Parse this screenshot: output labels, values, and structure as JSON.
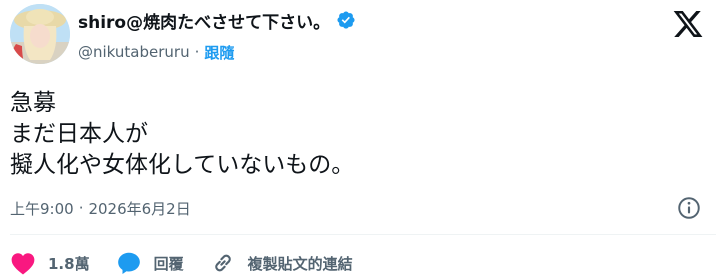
{
  "author": {
    "display_name": "shiro@焼肉たべさせて下さい。",
    "handle": "@nikutaberuru",
    "separator": "·",
    "follow_label": "跟隨",
    "verified": true
  },
  "tweet": {
    "lines": [
      "急募",
      "まだ日本人が",
      "擬人化や女体化していないもの。"
    ]
  },
  "meta": {
    "time": "上午9:00",
    "separator": "·",
    "date": "2026年6月2日"
  },
  "actions": {
    "like_count": "1.8萬",
    "reply_label": "回覆",
    "copy_link_label": "複製貼文的連結"
  },
  "colors": {
    "accent": "#1d9bf0",
    "like": "#f91880",
    "secondary_text": "#536471"
  },
  "icons": [
    "verified-badge-icon",
    "x-logo-icon",
    "info-icon",
    "heart-icon",
    "reply-icon",
    "link-icon"
  ]
}
